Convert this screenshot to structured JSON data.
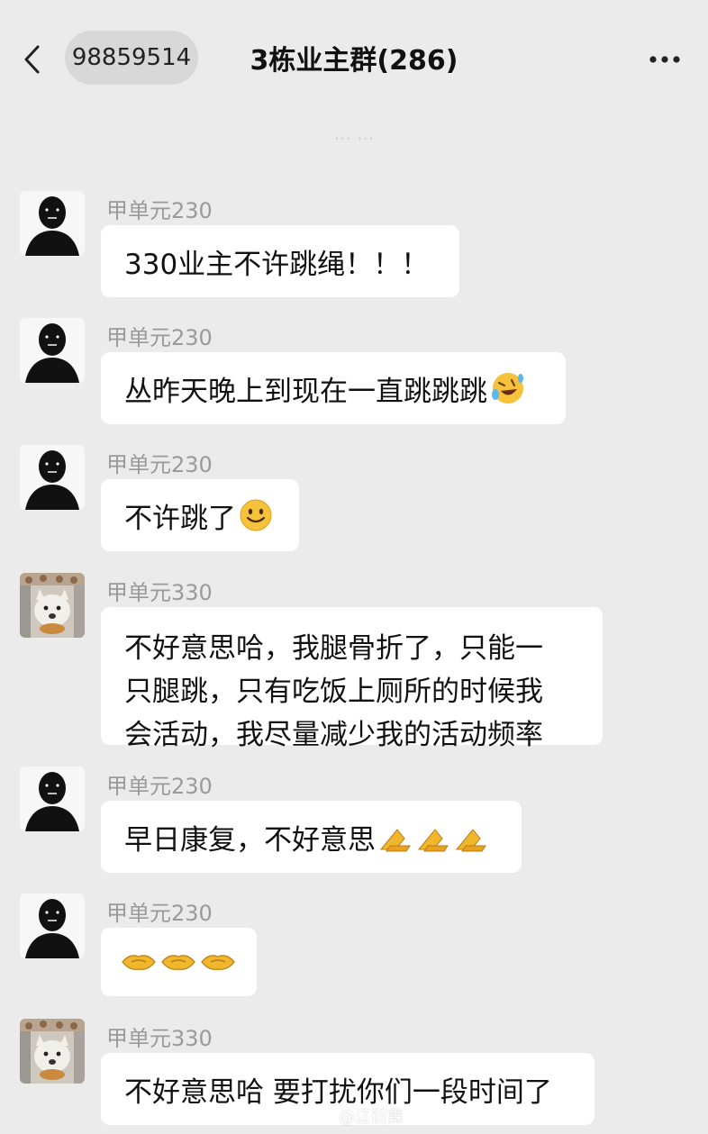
{
  "header": {
    "back_icon": "chevron-left-icon",
    "unread_count": "98859514",
    "title": "3栋业主群(286)",
    "more_icon": "ellipsis-icon"
  },
  "time_label": "··· ···",
  "messages": [
    {
      "sender": "甲单元230",
      "avatar": "silhouette-avatar",
      "text": "330业主不许跳绳！！！"
    },
    {
      "sender": "甲单元230",
      "avatar": "silhouette-avatar",
      "text": "丛昨天晚上到现在一直跳跳跳",
      "emoji": "rolling-laughing-emoji"
    },
    {
      "sender": "甲单元230",
      "avatar": "silhouette-avatar",
      "text": "不许跳了",
      "emoji": "smiling-emoji"
    },
    {
      "sender": "甲单元330",
      "avatar": "dog-photo-avatar",
      "lines": [
        "不好意思哈，我腿骨折了，只能一",
        "只腿跳，只有吃饭上厕所的时候我",
        "会活动，我尽量减少我的活动频率"
      ]
    },
    {
      "sender": "甲单元230",
      "avatar": "silhouette-avatar",
      "text": "早日康复，不好意思",
      "emoji": "folded-hands-emoji"
    },
    {
      "sender": "甲单元230",
      "avatar": "silhouette-avatar",
      "text": "",
      "emoji": "handshake-emoji"
    },
    {
      "sender": "甲单元330",
      "avatar": "dog-photo-avatar",
      "text": "不好意思哈 要打扰你们一段时间了"
    }
  ],
  "watermark": "@江衍霖",
  "colors": {
    "background": "#ebebeb",
    "bubble": "#ffffff",
    "sender_name": "#9a9a9a",
    "pill": "#d8d8d8"
  }
}
